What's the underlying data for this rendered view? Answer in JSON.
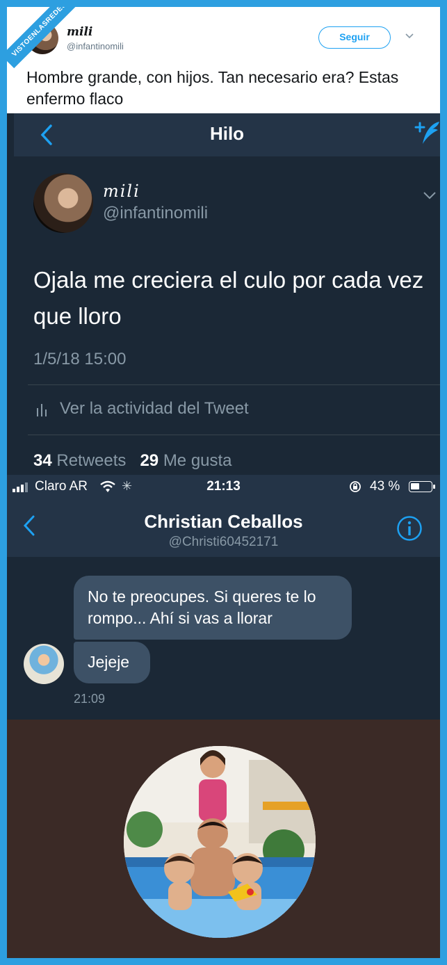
{
  "badge": "VISTOENLASREDES",
  "tweet": {
    "name": "mili",
    "handle": "@infantinomili",
    "follow_label": "Seguir",
    "text": "Hombre grande, con hijos. Tan necesario era? Estas enfermo flaco"
  },
  "thread": {
    "title": "Hilo",
    "name": "mili",
    "handle": "@infantinomili",
    "text": "Ojala me creciera el culo por cada vez que lloro",
    "date": "1/5/18 15:00",
    "activity_label": "Ver la actividad del Tweet",
    "retweets_count": "34",
    "retweets_label": "Retweets",
    "likes_count": "29",
    "likes_label": "Me gusta"
  },
  "dm": {
    "status": {
      "carrier": "Claro AR",
      "time": "21:13",
      "battery": "43 %"
    },
    "contact_name": "Christian Ceballos",
    "contact_handle": "@Christi60452171",
    "messages": [
      "No te preocupes. Si queres te lo rompo... Ahí si vas a llorar",
      "Jejeje"
    ],
    "message_time": "21:09"
  },
  "colors": {
    "accent": "#1da1f2",
    "dark_bg": "#1b2836",
    "bar_bg": "#243447",
    "bubble": "#3d5166"
  }
}
